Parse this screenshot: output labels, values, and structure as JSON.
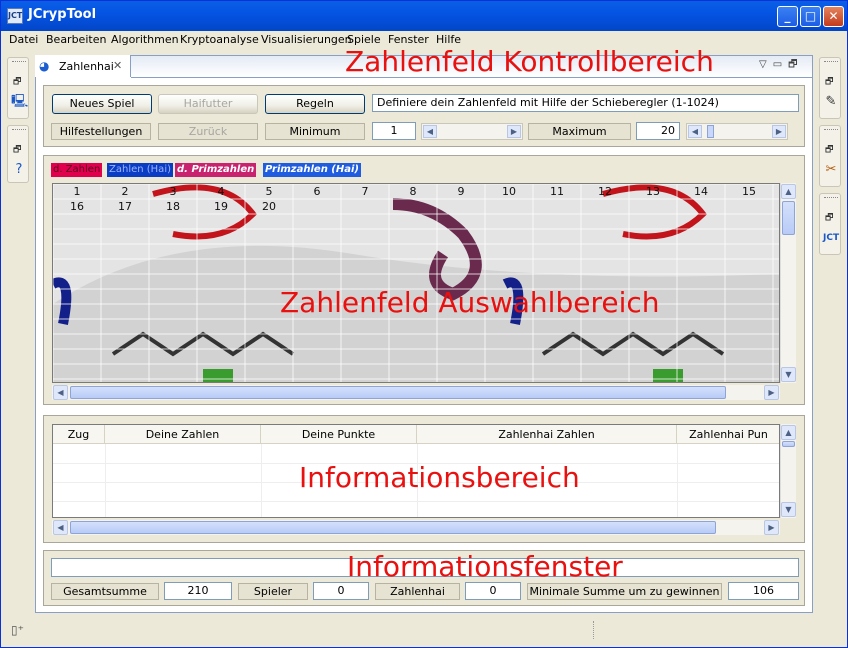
{
  "window": {
    "title": "JCrypTool",
    "app_icon": "JCT"
  },
  "menu": [
    "Datei",
    "Bearbeiten",
    "Algorithmen",
    "Kryptoanalyse",
    "Visualisierungen",
    "Spiele",
    "Fenster",
    "Hilfe"
  ],
  "view_tab": {
    "label": "Zahlenhai"
  },
  "overlay_labels": {
    "control": "Zahlenfeld Kontrollbereich",
    "board": "Zahlenfeld Auswahlbereich",
    "info": "Informationsbereich",
    "window": "Informationsfenster"
  },
  "controls": {
    "new_game": "Neues Spiel",
    "shark_food": "Haifutter",
    "rules": "Regeln",
    "description": "Definiere dein Zahlenfeld mit Hilfe der Schieberegler (1-1024)",
    "hints": "Hilfestellungen",
    "back": "Zurück",
    "minimum_label": "Minimum",
    "minimum_value": "1",
    "maximum_label": "Maximum",
    "maximum_value": "20"
  },
  "legend": {
    "your_numbers": "d. Zahlen",
    "shark_numbers": "Zahlen (Hai)",
    "your_primes": "d. Primzahlen",
    "shark_primes": "Primzahlen (Hai)"
  },
  "board": {
    "numbers": [
      "1",
      "2",
      "3",
      "4",
      "5",
      "6",
      "7",
      "8",
      "9",
      "10",
      "11",
      "12",
      "13",
      "14",
      "15",
      "16",
      "17",
      "18",
      "19",
      "20"
    ]
  },
  "info_table": {
    "columns": [
      "Zug",
      "Deine Zahlen",
      "Deine Punkte",
      "Zahlenhai Zahlen",
      "Zahlenhai Pun"
    ]
  },
  "summary": {
    "total_label": "Gesamtsumme",
    "total_value": "210",
    "player_label": "Spieler",
    "player_value": "0",
    "shark_label": "Zahlenhai",
    "shark_value": "0",
    "min_label": "Minimale Summe um zu gewinnen",
    "min_value": "106"
  },
  "colors": {
    "accent_red": "#e8110f",
    "your_numbers": "#e0004e",
    "shark_numbers": "#0a3cc4",
    "titlebar": "#0554e3"
  }
}
